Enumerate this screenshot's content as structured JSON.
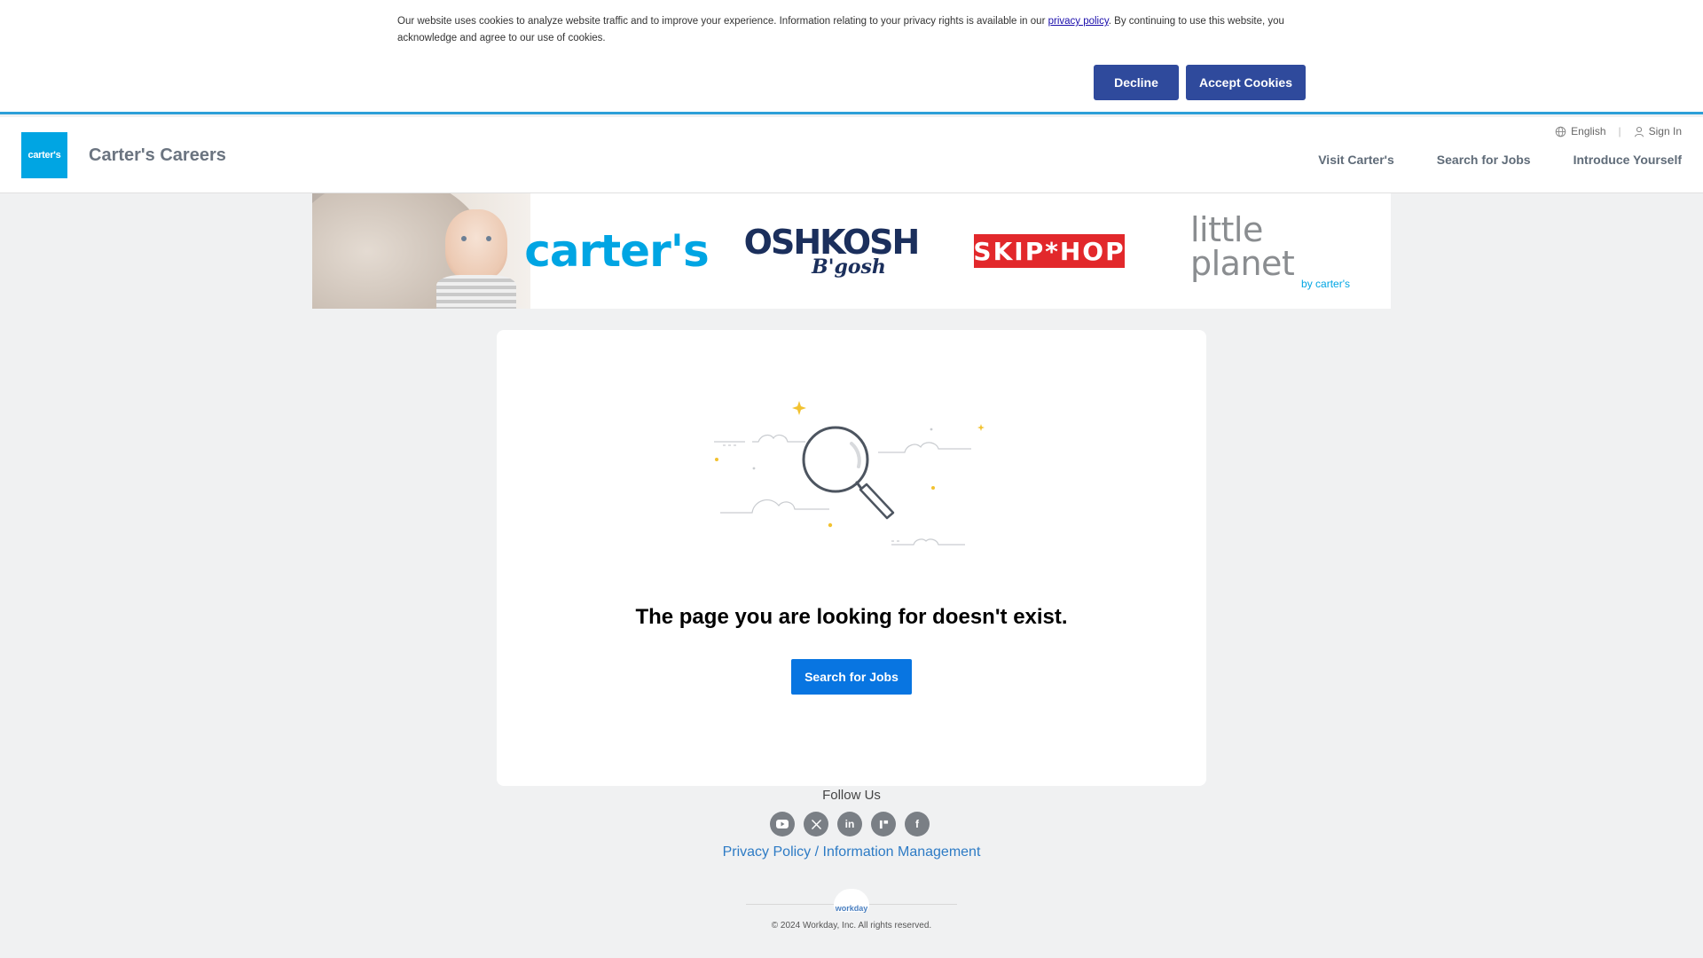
{
  "cookie_banner": {
    "text_before": "Our website uses cookies to analyze website traffic and to improve your experience. Information relating to your privacy rights is available in our ",
    "privacy_link": "privacy policy",
    "text_after": ". By continuing to use this website, you acknowledge and agree to our use of cookies.",
    "decline_label": "Decline",
    "accept_label": "Accept Cookies"
  },
  "header": {
    "logo_text": "carter's",
    "site_title": "Carter's Careers",
    "language": "English",
    "sign_in": "Sign In",
    "nav": [
      {
        "label": "Visit Carter's"
      },
      {
        "label": "Search for Jobs"
      },
      {
        "label": "Introduce Yourself"
      }
    ]
  },
  "brand_banner": {
    "carters": "carter's",
    "oshkosh_top": "OSHKOSH",
    "oshkosh_bottom": "B'gosh",
    "skiphop": "SKIP*HOP",
    "little_planet": "little planet",
    "little_planet_sub": "by carter's"
  },
  "main": {
    "heading": "The page you are looking for doesn't exist.",
    "cta_label": "Search for Jobs"
  },
  "footer": {
    "follow_label": "Follow Us",
    "social": [
      {
        "name": "youtube-icon",
        "glyph": "▶"
      },
      {
        "name": "x-icon",
        "glyph": "𝕏"
      },
      {
        "name": "linkedin-icon",
        "glyph": "in"
      },
      {
        "name": "glassdoor-icon",
        "glyph": "g"
      },
      {
        "name": "facebook-icon",
        "glyph": "f"
      }
    ],
    "privacy_link": "Privacy Policy / Information Management",
    "workday_logo": "workday",
    "copyright": "© 2024 Workday, Inc. All rights reserved."
  },
  "colors": {
    "accent_blue": "#0875e1",
    "cookie_button": "#2f4a9c",
    "brand_blue": "#00a5e3",
    "skiphop_red": "#e2282b",
    "page_background": "#f0f1f2"
  }
}
